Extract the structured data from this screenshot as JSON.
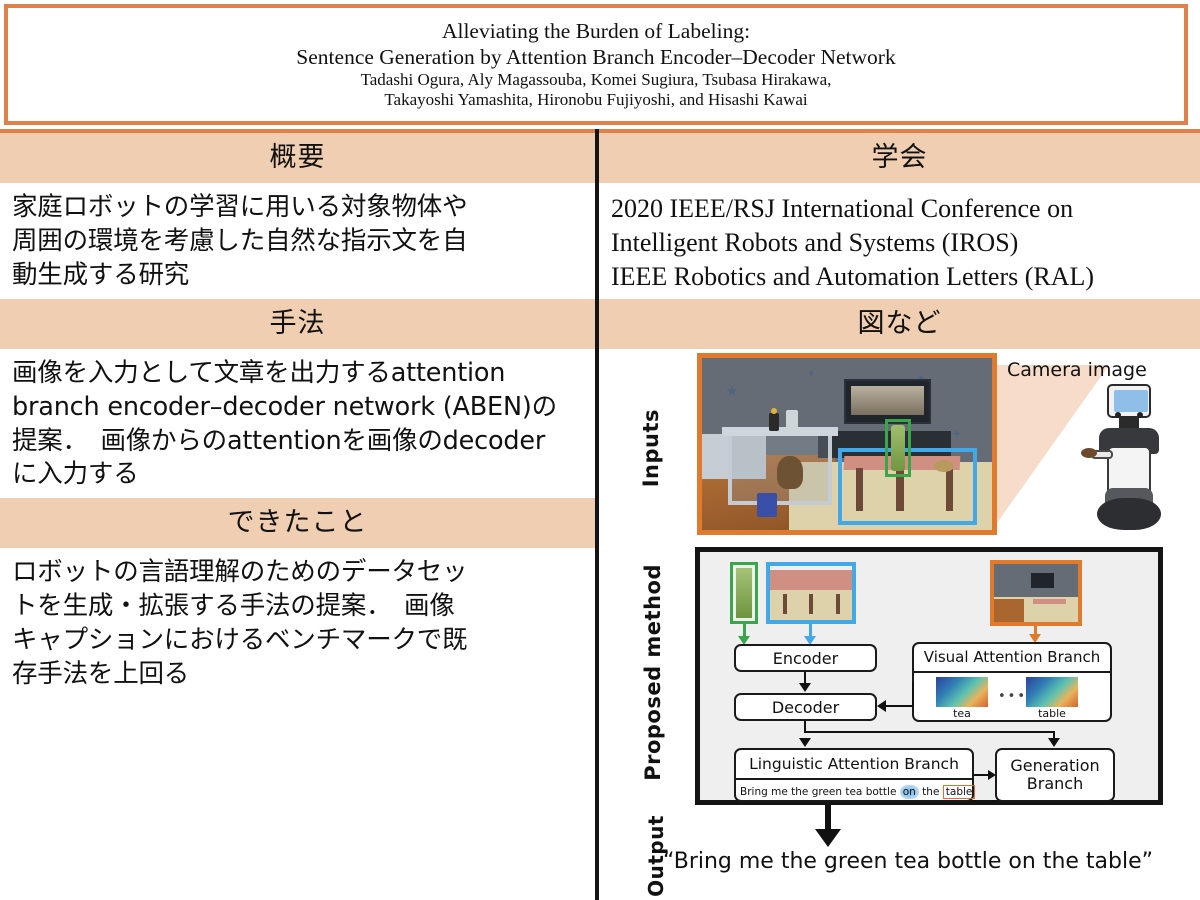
{
  "title": {
    "line1": "Alleviating the Burden of Labeling:",
    "line2": "Sentence Generation by Attention Branch Encoder–Decoder Network",
    "authors_line1": "Tadashi Ogura, Aly Magassouba, Komei Sugiura, Tsubasa Hirakawa,",
    "authors_line2": "Takayoshi Yamashita, Hironobu Fujiyoshi, and Hisashi Kawai"
  },
  "colors": {
    "accent_orange": "#E0814A",
    "band_peach": "#F0CEB2",
    "divider_black": "#141414",
    "green_box": "#3AA64A",
    "blue_box": "#43A8E8",
    "orange_box": "#E07B2E"
  },
  "left_column": {
    "sections": [
      {
        "heading": "概要",
        "lines": [
          "家庭ロボットの学習に用いる対象物体や",
          "周囲の環境を考慮した自然な指示文を自",
          "動生成する研究"
        ]
      },
      {
        "heading": "手法",
        "lines": [
          "画像を入力として文章を出力するattention",
          "branch encoder–decoder network (ABEN)の",
          "提案．　画像からのattentionを画像のdecoder",
          "に入力する"
        ]
      },
      {
        "heading": "できたこと",
        "lines": [
          "ロボットの言語理解のためのデータセッ",
          "トを生成・拡張する手法の提案．　画像",
          "キャプションにおけるベンチマークで既",
          "存手法を上回る"
        ]
      }
    ]
  },
  "right_column": {
    "conference": {
      "heading": "学会",
      "lines": [
        "2020 IEEE/RSJ International Conference on",
        "Intelligent Robots and Systems (IROS)",
        "IEEE Robotics and Automation Letters (RAL)"
      ]
    },
    "figures": {
      "heading": "図など",
      "inputs_label": "Inputs",
      "camera_label": "Camera image",
      "proposed_label": "Proposed method",
      "output_label": "Output",
      "output_text": "“Bring me the green tea bottle on the table”",
      "blocks": {
        "encoder": "Encoder",
        "decoder": "Decoder",
        "visual_attention_branch": "Visual Attention Branch",
        "linguistic_attention_branch": "Linguistic Attention Branch",
        "generation_branch_line1": "Generation",
        "generation_branch_line2": "Branch"
      },
      "attention_maps": [
        {
          "caption": "tea"
        },
        {
          "caption": "table"
        }
      ],
      "attention_ellipsis": "•••",
      "sentence": {
        "before": "Bring me the green tea bottle ",
        "highlight_word": "on",
        "middle": " the ",
        "boxed_word": "table"
      }
    }
  }
}
